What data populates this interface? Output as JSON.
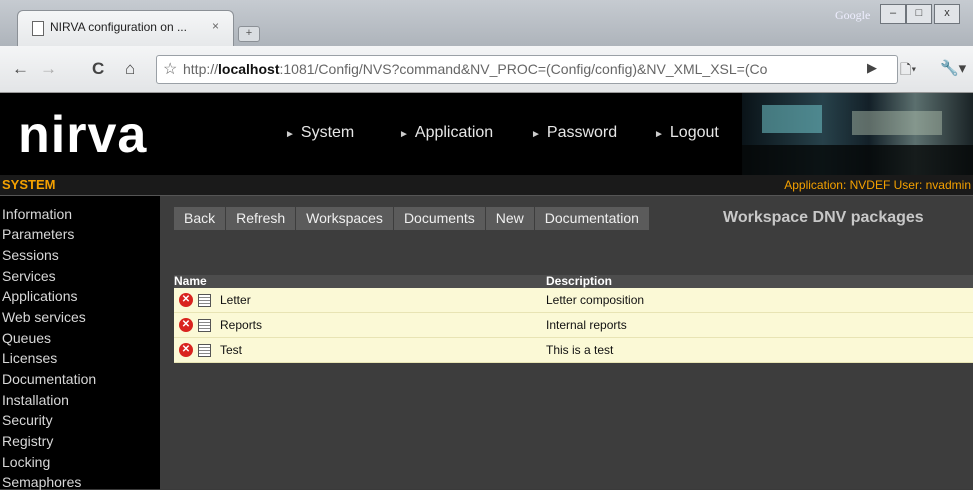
{
  "browser": {
    "tab_title": "NIRVA configuration on ...",
    "tab_close": "×",
    "new_tab": "+",
    "window_brand": "Google",
    "win_min": "–",
    "win_max": "□",
    "win_close": "x",
    "nav_back": "←",
    "nav_forward": "→",
    "nav_reload": "C",
    "nav_home": "⌂",
    "url_pre": "http://",
    "url_host": "localhost",
    "url_rest": ":1081/Config/NVS?command&NV_PROC=(Config/config)&NV_XML_XSL=(Co",
    "go_icon": "▶",
    "page_menu": "🗋▾",
    "wrench_menu": "🔧▾"
  },
  "header": {
    "logo": "nirva",
    "nav": [
      "System",
      "Application",
      "Password",
      "Logout"
    ],
    "nav_arrow": "►"
  },
  "system_bar": {
    "title": "SYSTEM",
    "app_info": "Application: NVDEF  User: nvadmin"
  },
  "sidebar": {
    "items": [
      "Information",
      "Parameters",
      "Sessions",
      "Services",
      "Applications",
      "Web services",
      "Queues",
      "Licenses",
      "Documentation",
      "Installation",
      "Security",
      "Registry",
      "Locking",
      "Semaphores"
    ]
  },
  "main": {
    "buttons": [
      "Back",
      "Refresh",
      "Workspaces",
      "Documents",
      "New",
      "Documentation"
    ],
    "title": "Workspace DNV packages",
    "table": {
      "headers": {
        "name": "Name",
        "description": "Description"
      },
      "rows": [
        {
          "name": "Letter",
          "description": "Letter composition"
        },
        {
          "name": "Reports",
          "description": "Internal reports"
        },
        {
          "name": "Test",
          "description": "This is a test"
        }
      ]
    }
  },
  "colors": {
    "accent": "#f5a100",
    "row_bg": "#fbf9d6",
    "delete": "#d9231e"
  }
}
